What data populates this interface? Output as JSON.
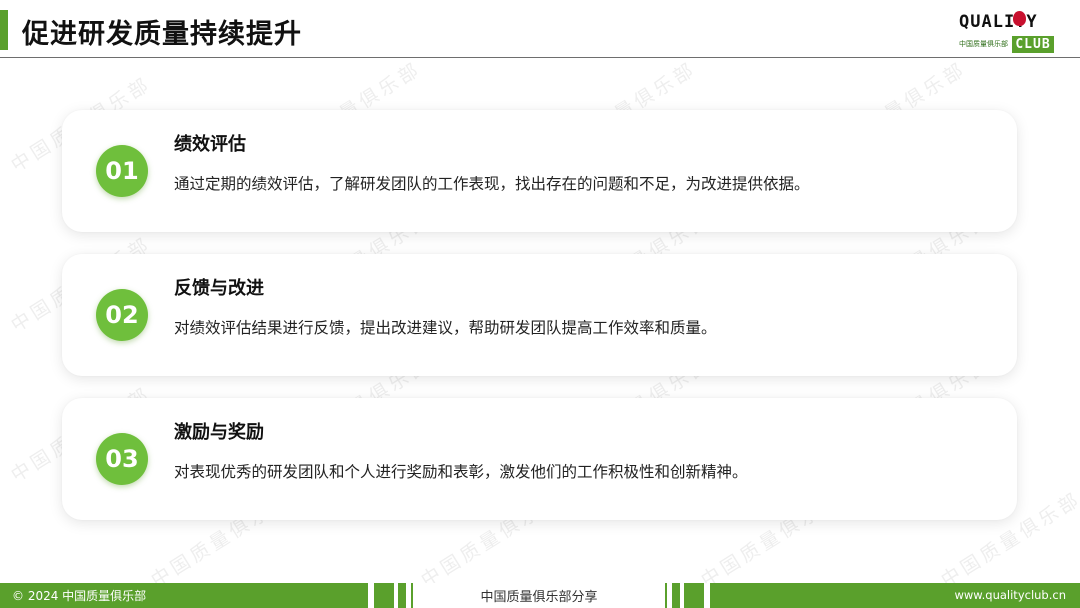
{
  "header": {
    "title": "促进研发质量持续提升",
    "logo": {
      "brand": "QUALITY",
      "sub": "中国质量俱乐部",
      "club": "CLUB"
    }
  },
  "watermark": "中国质量俱乐部",
  "cards": [
    {
      "number": "01",
      "title": "绩效评估",
      "description": "通过定期的绩效评估，了解研发团队的工作表现，找出存在的问题和不足，为改进提供依据。"
    },
    {
      "number": "02",
      "title": "反馈与改进",
      "description": "对绩效评估结果进行反馈，提出改进建议，帮助研发团队提高工作效率和质量。"
    },
    {
      "number": "03",
      "title": "激励与奖励",
      "description": "对表现优秀的研发团队和个人进行奖励和表彰，激发他们的工作积极性和创新精神。"
    }
  ],
  "footer": {
    "copyright": "© 2024 中国质量俱乐部",
    "center": "中国质量俱乐部分享",
    "url": "www.qualityclub.cn"
  },
  "colors": {
    "accent": "#5aa02c",
    "circle": "#6fbf3c"
  }
}
